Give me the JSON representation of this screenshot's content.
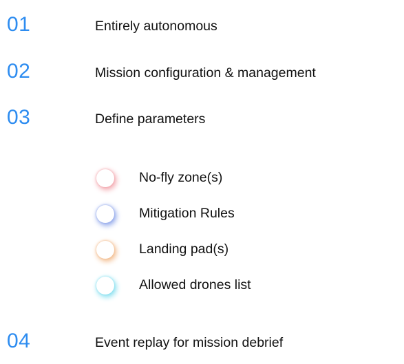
{
  "features": [
    {
      "number": "01",
      "label": "Entirely autonomous"
    },
    {
      "number": "02",
      "label": "Mission configuration & management"
    },
    {
      "number": "03",
      "label": "Define parameters"
    },
    {
      "number": "04",
      "label": "Event replay for mission debrief"
    }
  ],
  "parameters": [
    {
      "label": "No-fly zone(s)",
      "dot_glow_color": "#f2a6ad"
    },
    {
      "label": "Mitigation Rules",
      "dot_glow_color": "#8fa6ea"
    },
    {
      "label": "Landing pad(s)",
      "dot_glow_color": "#f2bb8c"
    },
    {
      "label": "Allowed drones list",
      "dot_glow_color": "#86dfef"
    }
  ],
  "colors": {
    "accent": "#2d8cf0",
    "text": "#111111",
    "background": "#ffffff"
  }
}
